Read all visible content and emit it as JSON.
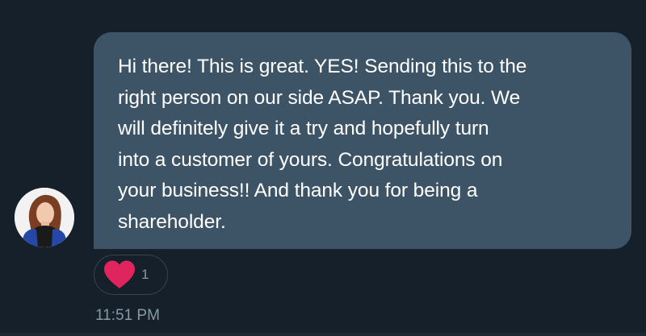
{
  "message": {
    "text": "Hi there! This is great. YES! Sending this to the\nright person on our side ASAP. Thank you. We\nwill definitely give it a try and hopefully turn\ninto a customer of yours. Congratulations on\nyour business!! And thank you for being a\nshareholder.",
    "timestamp": "11:51 PM"
  },
  "reaction": {
    "icon": "heart-icon",
    "count": "1",
    "color": "#e0245e"
  },
  "avatar": {
    "icon": "avatar-photo"
  },
  "colors": {
    "background": "#15202b",
    "bubble": "#3d5466",
    "text": "#ffffff",
    "muted": "#8899a6"
  }
}
